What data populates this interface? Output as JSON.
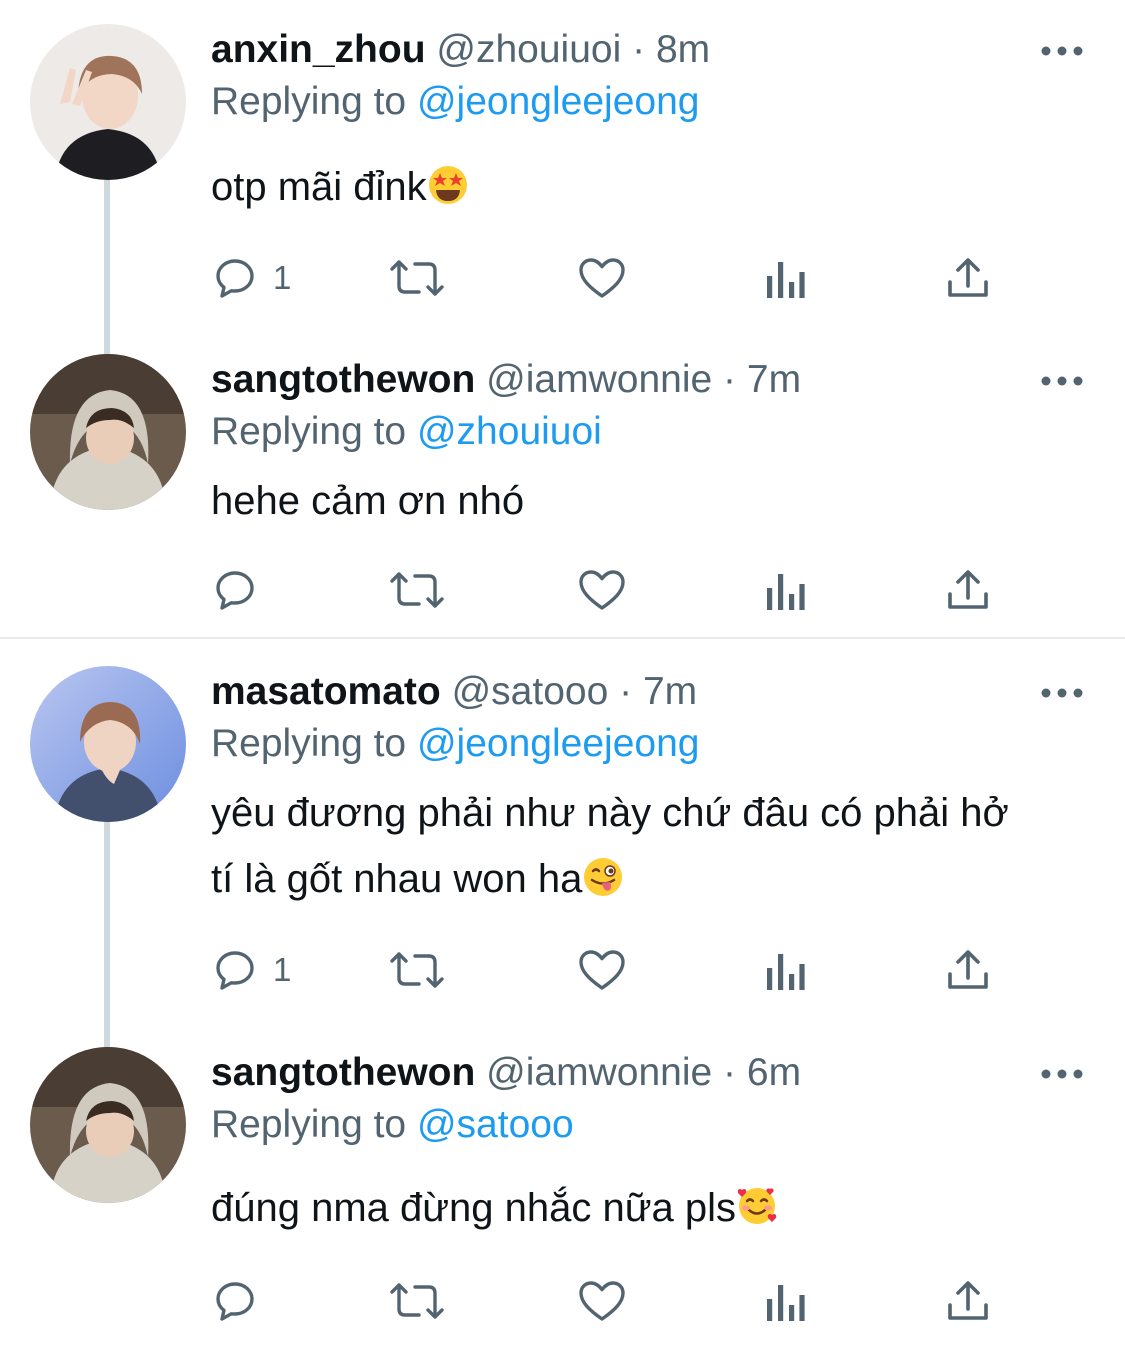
{
  "tweets": [
    {
      "display_name": "anxin_zhou",
      "handle": "@zhouiuoi",
      "separator": "·",
      "time": "8m",
      "replying_prefix": "Replying to",
      "replying_to": "@jeongleejeong",
      "text": "otp mãi đỉnk",
      "emoji": "star-struck-emoji",
      "reply_count": "1"
    },
    {
      "display_name": "sangtothewon",
      "handle": "@iamwonnie",
      "separator": "·",
      "time": "7m",
      "replying_prefix": "Replying to",
      "replying_to": "@zhouiuoi",
      "text": "hehe cảm ơn nhó",
      "reply_count": ""
    },
    {
      "display_name": "masatomato",
      "handle": "@satooo",
      "separator": "·",
      "time": "7m",
      "replying_prefix": "Replying to",
      "replying_to": "@jeongleejeong",
      "text_line1": "yêu đương phải như này chứ đâu có phải hở",
      "text_line2": "tí là gốt nhau won ha",
      "emoji": "winking-tongue-emoji",
      "reply_count": "1"
    },
    {
      "display_name": "sangtothewon",
      "handle": "@iamwonnie",
      "separator": "·",
      "time": "6m",
      "replying_prefix": "Replying to",
      "replying_to": "@satooo",
      "text": "đúng nma đừng nhắc nữa pls",
      "emoji": "smiling-hearts-emoji",
      "reply_count": ""
    }
  ],
  "colors": {
    "text": "#0f1419",
    "secondary": "#536471",
    "link": "#1d9bf0",
    "thread_line": "#cfd9de",
    "divider": "#e8ebed"
  },
  "icons": [
    "reply-icon",
    "retweet-icon",
    "like-icon",
    "analytics-icon",
    "share-icon",
    "more-icon"
  ]
}
